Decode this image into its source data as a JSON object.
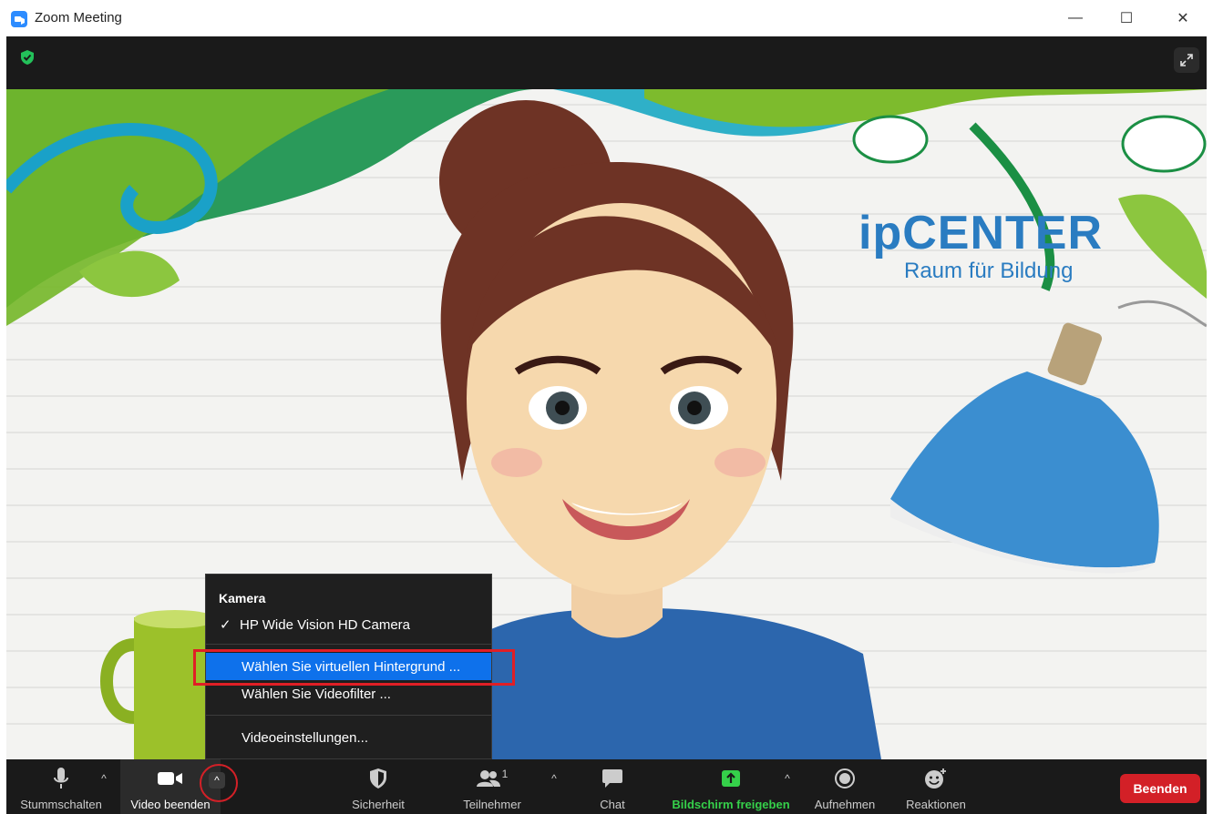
{
  "window": {
    "title": "Zoom Meeting",
    "controls": {
      "minimize": "—",
      "maximize": "☐",
      "close": "✕"
    }
  },
  "video_overlay": {
    "logo_main": "ipCENTER",
    "logo_prefix": "ip",
    "logo_suffix": "CENTER",
    "logo_tagline": "Raum für Bildung"
  },
  "video_menu": {
    "section_title": "Kamera",
    "camera_item": "HP Wide Vision HD Camera",
    "items": [
      {
        "label": "Wählen Sie virtuellen Hintergrund ..."
      },
      {
        "label": "Wählen Sie Videofilter ..."
      },
      {
        "label": "Videoeinstellungen..."
      }
    ]
  },
  "toolbar": {
    "mute_label": "Stummschalten",
    "video_label": "Video beenden",
    "security_label": "Sicherheit",
    "participants_label": "Teilnehmer",
    "participants_count": "1",
    "chat_label": "Chat",
    "share_label": "Bildschirm freigeben",
    "record_label": "Aufnehmen",
    "reactions_label": "Reaktionen",
    "end_label": "Beenden"
  },
  "colors": {
    "accent_blue": "#0e71eb",
    "end_red": "#d32027",
    "share_green": "#35d04a",
    "toolbar_bg": "#1a1a1a"
  },
  "icons": [
    "zoom-app-icon",
    "shield-check-icon",
    "expand-icon",
    "microphone-icon",
    "video-camera-icon",
    "security-shield-icon",
    "participants-icon",
    "chat-bubble-icon",
    "share-screen-icon",
    "record-icon",
    "reactions-icon",
    "caret-up-icon",
    "checkmark-icon"
  ]
}
